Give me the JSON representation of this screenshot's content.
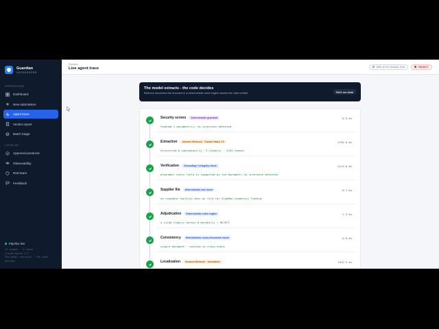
{
  "brand": {
    "name": "Guardian",
    "sub": "GATEKEEPER"
  },
  "sidebar": {
    "sections": [
      {
        "label": "OPERATIONS",
        "items": [
          {
            "label": "Dashboard",
            "icon": "grid-icon",
            "active": false
          },
          {
            "label": "New submission",
            "icon": "plus-icon",
            "active": false
          },
          {
            "label": "Agent trace",
            "icon": "trace-icon",
            "active": true
          },
          {
            "label": "Verdict report",
            "icon": "document-icon",
            "active": false
          },
          {
            "label": "Batch triage",
            "icon": "layers-icon",
            "active": false
          }
        ]
      },
      {
        "label": "CATALOG",
        "items": [
          {
            "label": "Approved products",
            "icon": "check-circle-icon",
            "active": false
          },
          {
            "label": "Observability",
            "icon": "eye-icon",
            "active": false
          },
          {
            "label": "Red-team",
            "icon": "shield-icon",
            "active": false
          },
          {
            "label": "Feedback",
            "icon": "chat-icon",
            "active": false
          }
        ]
      }
    ],
    "footer": {
      "status": "Pipeline live",
      "lines": [
        "12 stages · 2 lanes",
        "Claude Haiku 4.5",
        "The model extracts · the code",
        "decides"
      ]
    }
  },
  "topbar": {
    "breadcrumb": "Pipeline",
    "title": "Live agent trace",
    "submission_id": "SUB-0712-81A4A-434",
    "verdict": "REJECT"
  },
  "hero": {
    "title": "The model extracts - the code decides",
    "subtitle": "Bedrock structures the document; a deterministic rules engine issues the cited verdict.",
    "total": "5431 ms total"
  },
  "steps": [
    {
      "name": "Security screen",
      "tag": "Deterministic guardrail",
      "tag_color": "purple",
      "ms": "0.5 ms",
      "detail": "Scanned 1 document(s); no injection detected"
    },
    {
      "name": "Extraction",
      "tag": "Amazon Bedrock · Claude Haiku 4.5",
      "tag_color": "amber",
      "ms": "2794.6 ms",
      "detail": "Structured 8 ingredient(s), 3 claim(s) · 2341 tokens"
    },
    {
      "name": "Verification",
      "tag": "Grounding + integrity check",
      "tag_color": "blue",
      "ms": "1111.8 ms",
      "detail": "grounded: every field is supported by the document; no inference detected"
    },
    {
      "name": "Supplier file",
      "tag": "Deterministic doc reuse",
      "tag_color": "blue",
      "ms": "0.1 ms",
      "detail": "no reusable facility docs on file for GlowMax Cosmetics Trading"
    },
    {
      "name": "Adjudication",
      "tag": "Deterministic rules engine",
      "tag_color": "blue",
      "ms": "1.3 ms",
      "detail": "4 cited flag(s) across 8 market(s) → REJECT"
    },
    {
      "name": "Consistency",
      "tag": "Deterministic cross-document check",
      "tag_color": "blue",
      "ms": "0.0 ms",
      "detail": "single document · nothing to cross-check"
    },
    {
      "name": "Localization",
      "tag": "Amazon Bedrock · translation",
      "tag_color": "amber",
      "ms": "1522.5 ms",
      "detail": ""
    }
  ],
  "colors": {
    "sidebar_bg": "#0f1a2c",
    "accent": "#2563eb",
    "success": "#16a34a",
    "reject": "#dc2626"
  }
}
